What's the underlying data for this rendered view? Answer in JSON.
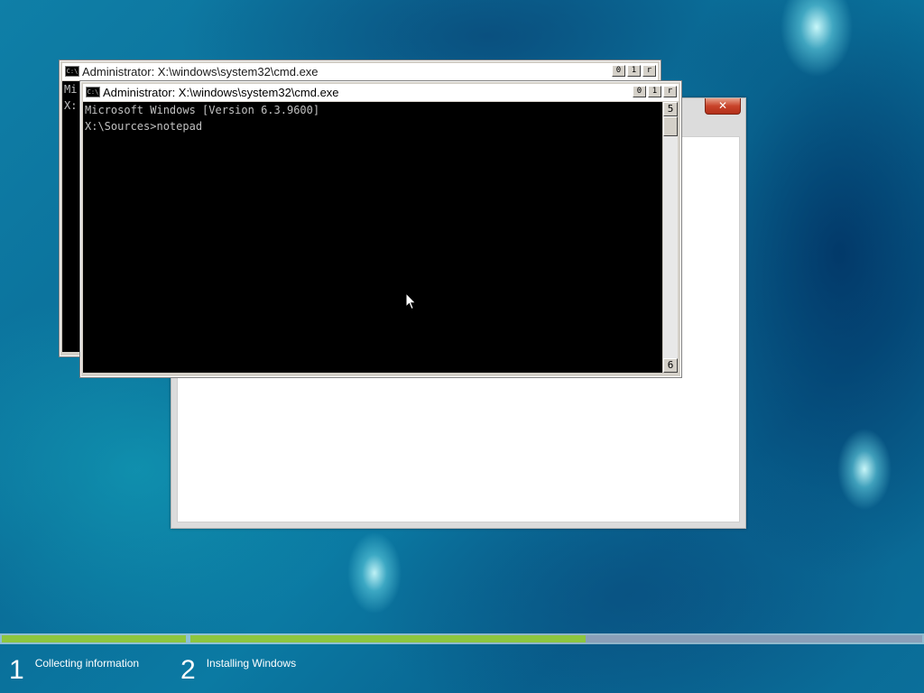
{
  "setup_window": {
    "close_glyph": "✕"
  },
  "cmd_back": {
    "title": "Administrator: X:\\windows\\system32\\cmd.exe",
    "app_icon_text": "C:\\",
    "buttons": {
      "minimize": "0",
      "maximize": "1",
      "close": "r"
    },
    "console_lines": [
      "Mi",
      "",
      "X:"
    ]
  },
  "cmd_front": {
    "title": "Administrator: X:\\windows\\system32\\cmd.exe",
    "app_icon_text": "C:\\",
    "buttons": {
      "minimize": "0",
      "maximize": "1",
      "close": "r"
    },
    "console_lines": [
      "Microsoft Windows [Version 6.3.9600]",
      "",
      "X:\\Sources>notepad"
    ],
    "scroll_up_glyph": "5",
    "scroll_down_glyph": "6"
  },
  "progress": {
    "steps": [
      {
        "number": "1",
        "label": "Collecting information",
        "fill_fraction": 1.0
      },
      {
        "number": "2",
        "label": "Installing Windows",
        "fill_fraction": 0.54
      }
    ]
  },
  "colors": {
    "progress_fill": "#8dc63f",
    "progress_track": "#8a9fb8",
    "console_bg": "#000000",
    "console_text": "#c0c0c0"
  }
}
